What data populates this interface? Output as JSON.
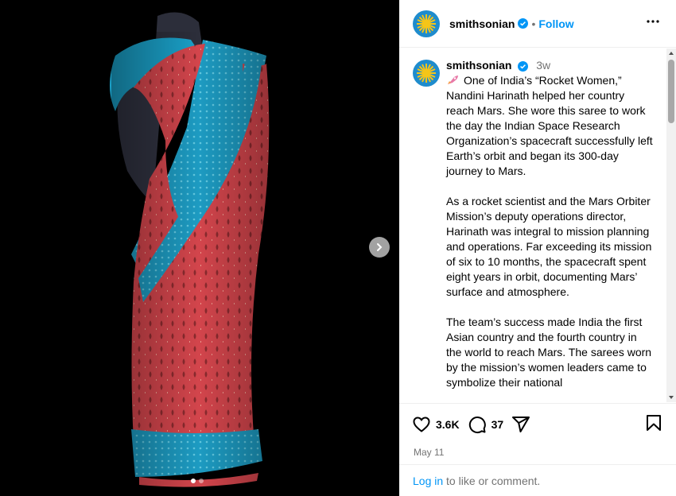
{
  "post": {
    "username": "smithsonian",
    "follow_label": "Follow",
    "separator": "•",
    "time_ago": "3w",
    "caption_paragraphs": [
      "One of India’s “Rocket Women,” Nandini Harinath helped her country reach Mars. She wore this saree to work the day the Indian Space Research Organization’s spacecraft successfully left Earth’s orbit and began its 300-day journey to Mars.",
      "As a rocket scientist and the Mars Orbiter Mission’s deputy operations director, Harinath was integral to mission planning and operations. Far exceeding its mission of six to 10 months, the spacecraft spent eight years in orbit, documenting Mars’ surface and atmosphere.",
      "The team’s success made India the first Asian country and the fourth country in the world to reach Mars. The sarees worn by the mission’s women leaders came to symbolize their national"
    ],
    "caption_emoji": "rocket-icon",
    "likes": "3.6K",
    "comments": "37",
    "date": "May 11",
    "login_link": "Log in",
    "login_text": " to like or comment."
  },
  "carousel": {
    "count": 2,
    "active": 0
  },
  "colors": {
    "accent": "#0095f6",
    "verified": "#0095f6",
    "avatar": "#1f8ccd",
    "saree_red": "#d8484e",
    "saree_blue": "#1f9fc4"
  }
}
